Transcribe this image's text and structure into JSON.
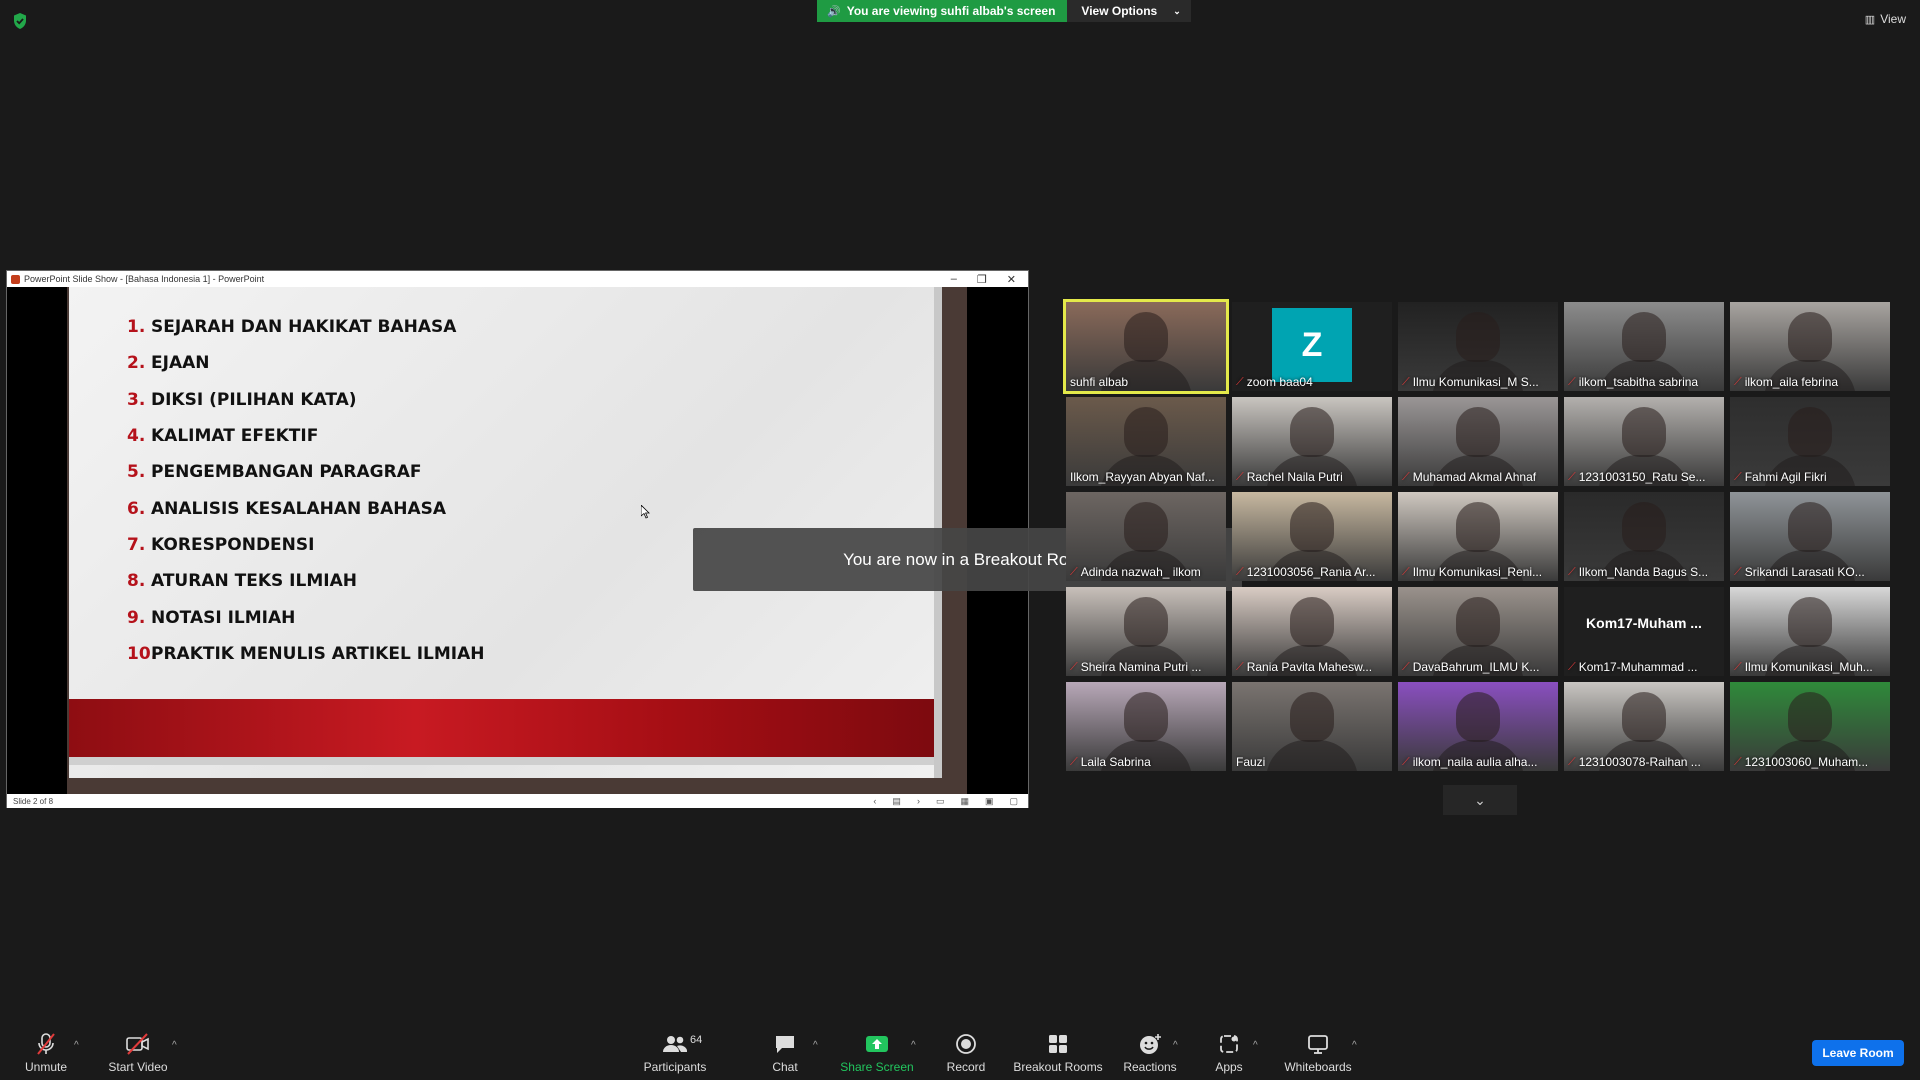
{
  "top": {
    "viewing_text": "You are viewing suhfi albab's screen",
    "view_options": "View Options",
    "view_label": "View"
  },
  "ppt": {
    "window_title": "PowerPoint Slide Show - [Bahasa Indonesia 1] - PowerPoint",
    "status_text": "Slide 2 of 8",
    "items": [
      {
        "num": "1.",
        "text": "SEJARAH DAN HAKIKAT BAHASA"
      },
      {
        "num": "2.",
        "text": "EJAAN"
      },
      {
        "num": "3.",
        "text": "DIKSI (PILIHAN KATA)"
      },
      {
        "num": "4.",
        "text": "KALIMAT EFEKTIF"
      },
      {
        "num": "5.",
        "text": "PENGEMBANGAN PARAGRAF"
      },
      {
        "num": "6.",
        "text": "ANALISIS KESALAHAN BAHASA"
      },
      {
        "num": "7.",
        "text": "KORESPONDENSI"
      },
      {
        "num": "8.",
        "text": "ATURAN TEKS ILMIAH"
      },
      {
        "num": "9.",
        "text": "NOTASI ILMIAH"
      },
      {
        "num": "10.",
        "text": "PRAKTIK MENULIS ARTIKEL ILMIAH"
      }
    ]
  },
  "toast": "You are now in a Breakout Room",
  "gallery": {
    "participants": [
      {
        "name": "suhfi albab",
        "muted": false,
        "active": true,
        "bg": "#8a6a5a"
      },
      {
        "name": "zoom baa04",
        "muted": true,
        "avatar": "Z",
        "bg": "#1f1f1f"
      },
      {
        "name": "Ilmu Komunikasi_M S...",
        "muted": true,
        "bg": "#222222"
      },
      {
        "name": "ilkom_tsabitha sabrina",
        "muted": true,
        "bg": "#8c8c8c"
      },
      {
        "name": "ilkom_aila febrina",
        "muted": true,
        "bg": "#a8a4a0"
      },
      {
        "name": "Ilkom_Rayyan Abyan Naf...",
        "muted": false,
        "bg": "#6b5a4b"
      },
      {
        "name": "Rachel Naila Putri",
        "muted": true,
        "bg": "#c9c5c0"
      },
      {
        "name": "Muhamad Akmal Ahnaf",
        "muted": true,
        "bg": "#9a9696"
      },
      {
        "name": "1231003150_Ratu Se...",
        "muted": true,
        "bg": "#b3b0ad"
      },
      {
        "name": "Fahmi Agil Fikri",
        "muted": true,
        "bg": "#2e2e2e"
      },
      {
        "name": "Adinda nazwah_ ilkom",
        "muted": true,
        "bg": "#6d6662"
      },
      {
        "name": "1231003056_Rania Ar...",
        "muted": true,
        "bg": "#c7b8a0"
      },
      {
        "name": "Ilmu Komunikasi_Reni...",
        "muted": true,
        "bg": "#cfc8c0"
      },
      {
        "name": "Ilkom_Nanda Bagus S...",
        "muted": true,
        "bg": "#2a2a2a"
      },
      {
        "name": "Srikandi Larasati KO...",
        "muted": true,
        "bg": "#8f9498"
      },
      {
        "name": "Sheira Namina Putri ...",
        "muted": true,
        "bg": "#c8c0ba"
      },
      {
        "name": "Rania Pavita Mahesw...",
        "muted": true,
        "bg": "#d9ccc4"
      },
      {
        "name": "DavaBahrum_ILMU K...",
        "muted": true,
        "bg": "#9a928c"
      },
      {
        "name": "Kom17-Muhammad ...",
        "muted": true,
        "text_only": "Kom17-Muham ...",
        "bg": "#1f1f1f"
      },
      {
        "name": "Ilmu Komunikasi_Muh...",
        "muted": true,
        "bg": "#d8d8d8"
      },
      {
        "name": "Laila Sabrina",
        "muted": true,
        "bg": "#b8a8b8"
      },
      {
        "name": "Fauzi",
        "muted": false,
        "bg": "#7a7470"
      },
      {
        "name": "ilkom_naila aulia alha...",
        "muted": true,
        "bg": "#8a4fc0"
      },
      {
        "name": "1231003078-Raihan ...",
        "muted": true,
        "bg": "#c9c6c2"
      },
      {
        "name": "1231003060_Muham...",
        "muted": true,
        "bg": "#2f8a3a"
      }
    ]
  },
  "toolbar": {
    "unmute": "Unmute",
    "start_video": "Start Video",
    "participants": "Participants",
    "participants_count": "64",
    "chat": "Chat",
    "share_screen": "Share Screen",
    "record": "Record",
    "breakout_rooms": "Breakout Rooms",
    "reactions": "Reactions",
    "apps": "Apps",
    "whiteboards": "Whiteboards",
    "leave_room": "Leave Room"
  }
}
